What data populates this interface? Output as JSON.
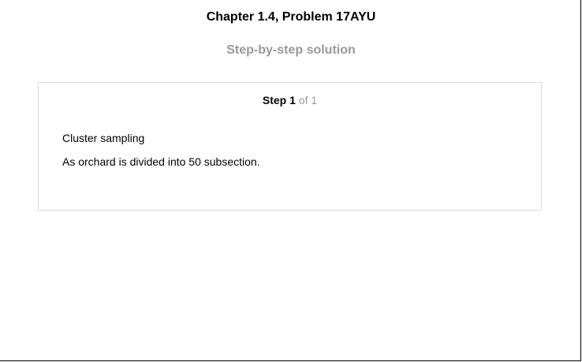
{
  "header": {
    "title": "Chapter 1.4, Problem 17AYU",
    "subtitle": "Step-by-step solution"
  },
  "step": {
    "label": "Step",
    "number": "1",
    "of_text": "of 1",
    "lines": [
      "Cluster sampling",
      "As orchard is divided into 50 subsection."
    ]
  },
  "colors": {
    "subtitle": "#999999",
    "of_text": "#999999",
    "card_border": "#dcdcdc"
  }
}
